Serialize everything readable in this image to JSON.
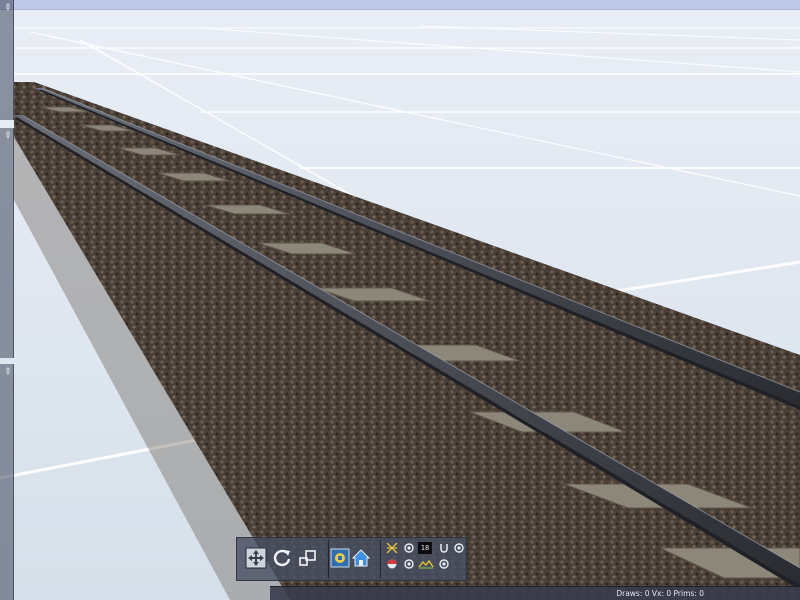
{
  "scene": {
    "description_icon": "railway-track-3d-view"
  },
  "toolbar": {
    "buttons": [
      {
        "icon": "move-arrows-icon"
      },
      {
        "icon": "rotate-icon"
      },
      {
        "icon": "scale-resize-icon"
      },
      {
        "icon": "object-properties-icon"
      },
      {
        "icon": "home-camera-icon"
      }
    ],
    "toggles": [
      {
        "icon": "grid-toggle-icon"
      },
      {
        "icon": "radio-toggle-icon"
      },
      {
        "icon": "snap-toggle-icon"
      },
      {
        "icon": "radio-toggle-icon"
      },
      {
        "icon": "light-toggle-icon"
      },
      {
        "icon": "radio-toggle-icon"
      },
      {
        "icon": "terrain-toggle-icon"
      },
      {
        "icon": "radio-toggle-icon"
      }
    ],
    "number_value": "18"
  },
  "status": {
    "text": "Draws: 0 Vx: 0 Prims: 0"
  },
  "colors": {
    "ground": "#dde6ef",
    "grid_line": "#ffffff",
    "ballast": "#4a3f36",
    "rail": "#3a3d44",
    "sleeper": "#8a8478",
    "panel": "#46506a"
  }
}
